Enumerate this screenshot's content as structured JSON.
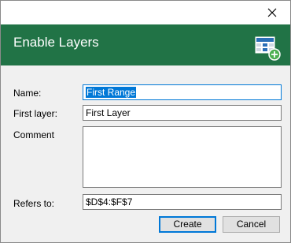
{
  "banner": {
    "title": "Enable Layers"
  },
  "form": {
    "name_label": "Name:",
    "name_value": "First Range",
    "first_layer_label": "First layer:",
    "first_layer_value": "First Layer",
    "comment_label": "Comment",
    "comment_value": "",
    "refers_to_label": "Refers to:",
    "refers_to_value": "$D$4:$F$7"
  },
  "buttons": {
    "create": "Create",
    "cancel": "Cancel"
  },
  "colors": {
    "banner_green": "#217346",
    "focus_blue": "#0078d7",
    "dialog_bg": "#f0f0f0"
  },
  "icons": {
    "close": "close-icon",
    "layers": "layers-add-icon"
  }
}
